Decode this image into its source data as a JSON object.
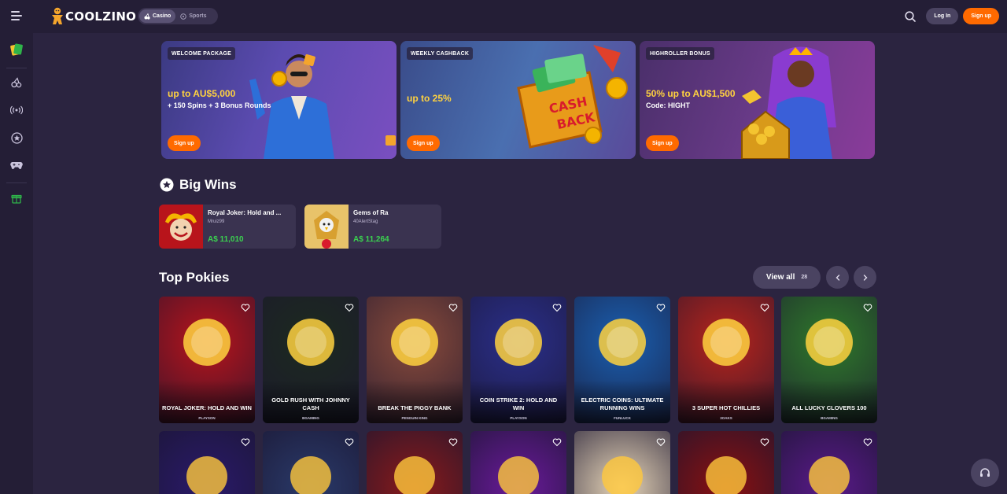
{
  "header": {
    "brand": "COOLZINO",
    "modes": [
      "Casino",
      "Sports"
    ],
    "login_label": "Log In",
    "signup_label": "Sign up"
  },
  "banners": [
    {
      "tag": "WELCOME PACKAGE",
      "headline": "up to AU$5,000",
      "sub": "+ 150 Spins + 3 Bonus Rounds",
      "cta": "Sign up",
      "accent": "#5b4bb0"
    },
    {
      "tag": "WEEKLY CASHBACK",
      "headline": "up to 25%",
      "sub": "",
      "cta": "Sign up",
      "accent": "#4a6fb0"
    },
    {
      "tag": "HIGHROLLER BONUS",
      "headline": "50% up to AU$1,500",
      "sub": "Code: HIGHT",
      "cta": "Sign up",
      "accent": "#6b3b8a"
    }
  ],
  "big_wins": {
    "title": "Big Wins",
    "items": [
      {
        "game": "Royal Joker: Hold and ...",
        "user": "Mruiz99",
        "amount": "A$ 11,010"
      },
      {
        "game": "Gems of Ra",
        "user": "40AlertStag",
        "amount": "A$ 11,264"
      }
    ]
  },
  "top_pokies": {
    "title": "Top Pokies",
    "view_all": "View all",
    "count": "28",
    "games": [
      {
        "name": "ROYAL JOKER: HOLD AND WIN",
        "provider": "PLAYSON",
        "color": "#b8141b"
      },
      {
        "name": "GOLD RUSH WITH JOHNNY CASH",
        "provider": "BGAMING",
        "color": "#1d2a1f"
      },
      {
        "name": "BREAK THE PIGGY BANK",
        "provider": "PENGUIN KING",
        "color": "#8a4b3a"
      },
      {
        "name": "COIN STRIKE 2: HOLD AND WIN",
        "provider": "PLAYSON",
        "color": "#2a2f8a"
      },
      {
        "name": "ELECTRIC COINS: ULTIMATE RUNNING WINS",
        "provider": "FUNLUCK",
        "color": "#1a5fb0"
      },
      {
        "name": "3 SUPER HOT CHILLIES",
        "provider": "3OAKS",
        "color": "#b8241b"
      },
      {
        "name": "ALL LUCKY CLOVERS 100",
        "provider": "BGAMING",
        "color": "#2f7a2a"
      }
    ],
    "row2_colors": [
      "#2a1a6a",
      "#2a3a6a",
      "#8a1a1a",
      "#6a1a9a",
      "#e8d6b8",
      "#8a1010",
      "#5a1a8a"
    ]
  }
}
